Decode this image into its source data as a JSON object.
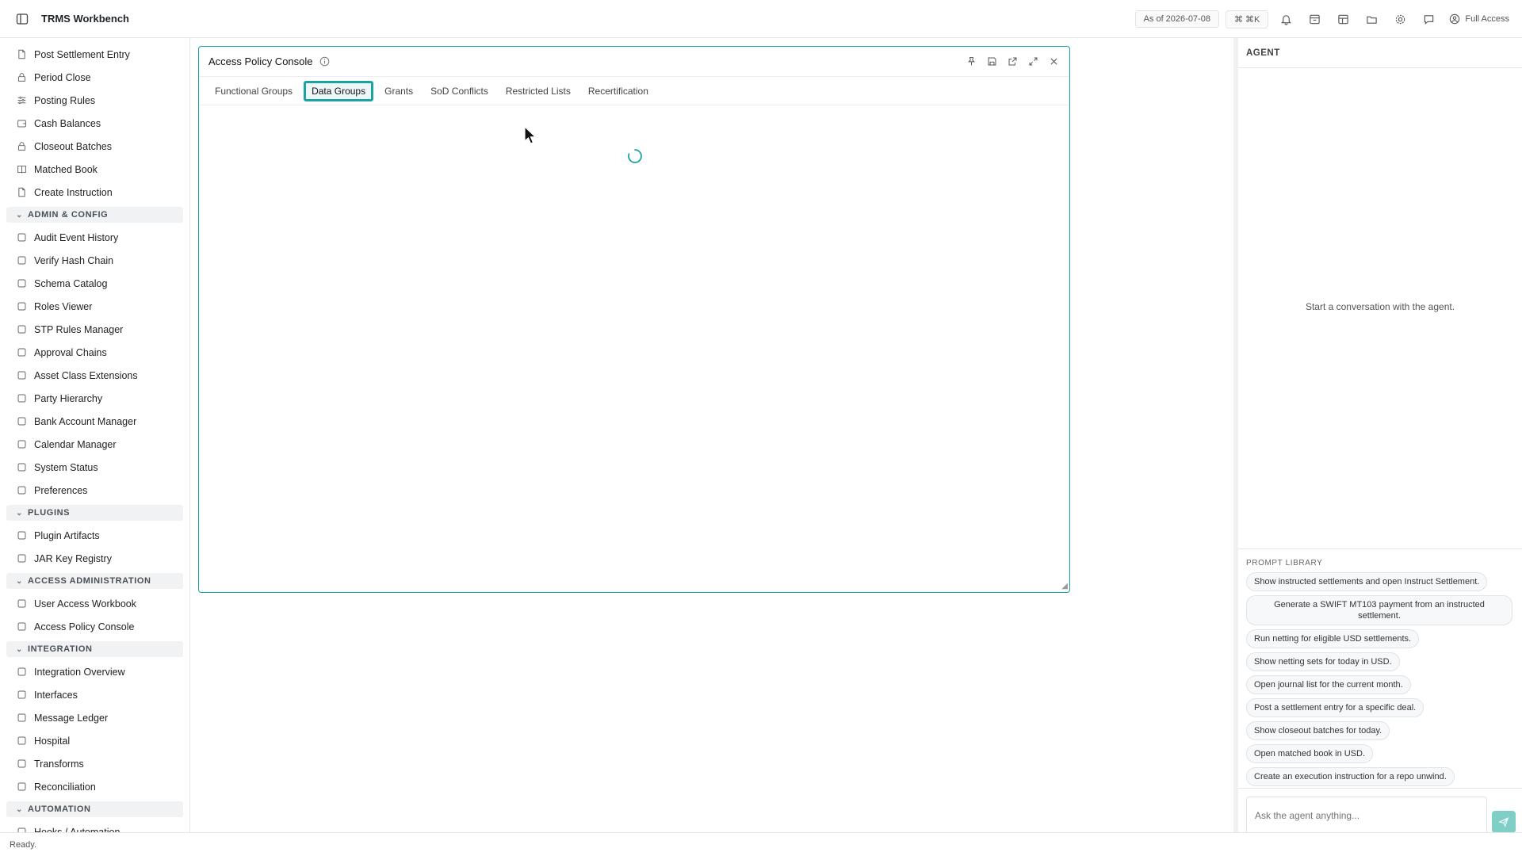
{
  "app": {
    "title": "TRMS Workbench",
    "as_of": "As of 2026-07-08",
    "shortcut": "⌘ ⌘K",
    "access_label": "Full Access"
  },
  "sidebar": {
    "items_top": [
      {
        "label": "Post Settlement Entry",
        "icon": "doc-icon"
      },
      {
        "label": "Period Close",
        "icon": "lock-icon"
      },
      {
        "label": "Posting Rules",
        "icon": "sliders-icon"
      },
      {
        "label": "Cash Balances",
        "icon": "wallet-icon"
      },
      {
        "label": "Closeout Batches",
        "icon": "lock-icon"
      },
      {
        "label": "Matched Book",
        "icon": "book-icon"
      },
      {
        "label": "Create Instruction",
        "icon": "doc-icon"
      }
    ],
    "sections": [
      {
        "title": "ADMIN & CONFIG",
        "items": [
          {
            "label": "Audit Event History"
          },
          {
            "label": "Verify Hash Chain"
          },
          {
            "label": "Schema Catalog"
          },
          {
            "label": "Roles Viewer"
          },
          {
            "label": "STP Rules Manager"
          },
          {
            "label": "Approval Chains"
          },
          {
            "label": "Asset Class Extensions"
          },
          {
            "label": "Party Hierarchy"
          },
          {
            "label": "Bank Account Manager"
          },
          {
            "label": "Calendar Manager"
          },
          {
            "label": "System Status"
          },
          {
            "label": "Preferences"
          }
        ]
      },
      {
        "title": "PLUGINS",
        "items": [
          {
            "label": "Plugin Artifacts"
          },
          {
            "label": "JAR Key Registry"
          }
        ]
      },
      {
        "title": "ACCESS ADMINISTRATION",
        "items": [
          {
            "label": "User Access Workbook"
          },
          {
            "label": "Access Policy Console"
          }
        ]
      },
      {
        "title": "INTEGRATION",
        "items": [
          {
            "label": "Integration Overview"
          },
          {
            "label": "Interfaces"
          },
          {
            "label": "Message Ledger"
          },
          {
            "label": "Hospital"
          },
          {
            "label": "Transforms"
          },
          {
            "label": "Reconciliation"
          }
        ]
      },
      {
        "title": "AUTOMATION",
        "items": [
          {
            "label": "Hooks / Automation"
          }
        ]
      }
    ]
  },
  "panel": {
    "title": "Access Policy Console",
    "tabs": [
      "Functional Groups",
      "Data Groups",
      "Grants",
      "SoD Conflicts",
      "Restricted Lists",
      "Recertification"
    ],
    "active_tab": "Data Groups"
  },
  "agent": {
    "header": "AGENT",
    "empty_text": "Start a conversation with the agent.",
    "prompt_library_title": "PROMPT LIBRARY",
    "prompts": [
      "Show instructed settlements and open Instruct Settlement.",
      "Generate a SWIFT MT103 payment from an instructed settlement.",
      "Run netting for eligible USD settlements.",
      "Show netting sets for today in USD.",
      "Open journal list for the current month.",
      "Post a settlement entry for a specific deal.",
      "Show closeout batches for today.",
      "Open matched book in USD.",
      "Create an execution instruction for a repo unwind."
    ],
    "input_placeholder": "Ask the agent anything..."
  },
  "status": {
    "text": "Ready."
  },
  "colors": {
    "accent": "#1aa3a0",
    "send_button": "#7fcfc7"
  }
}
